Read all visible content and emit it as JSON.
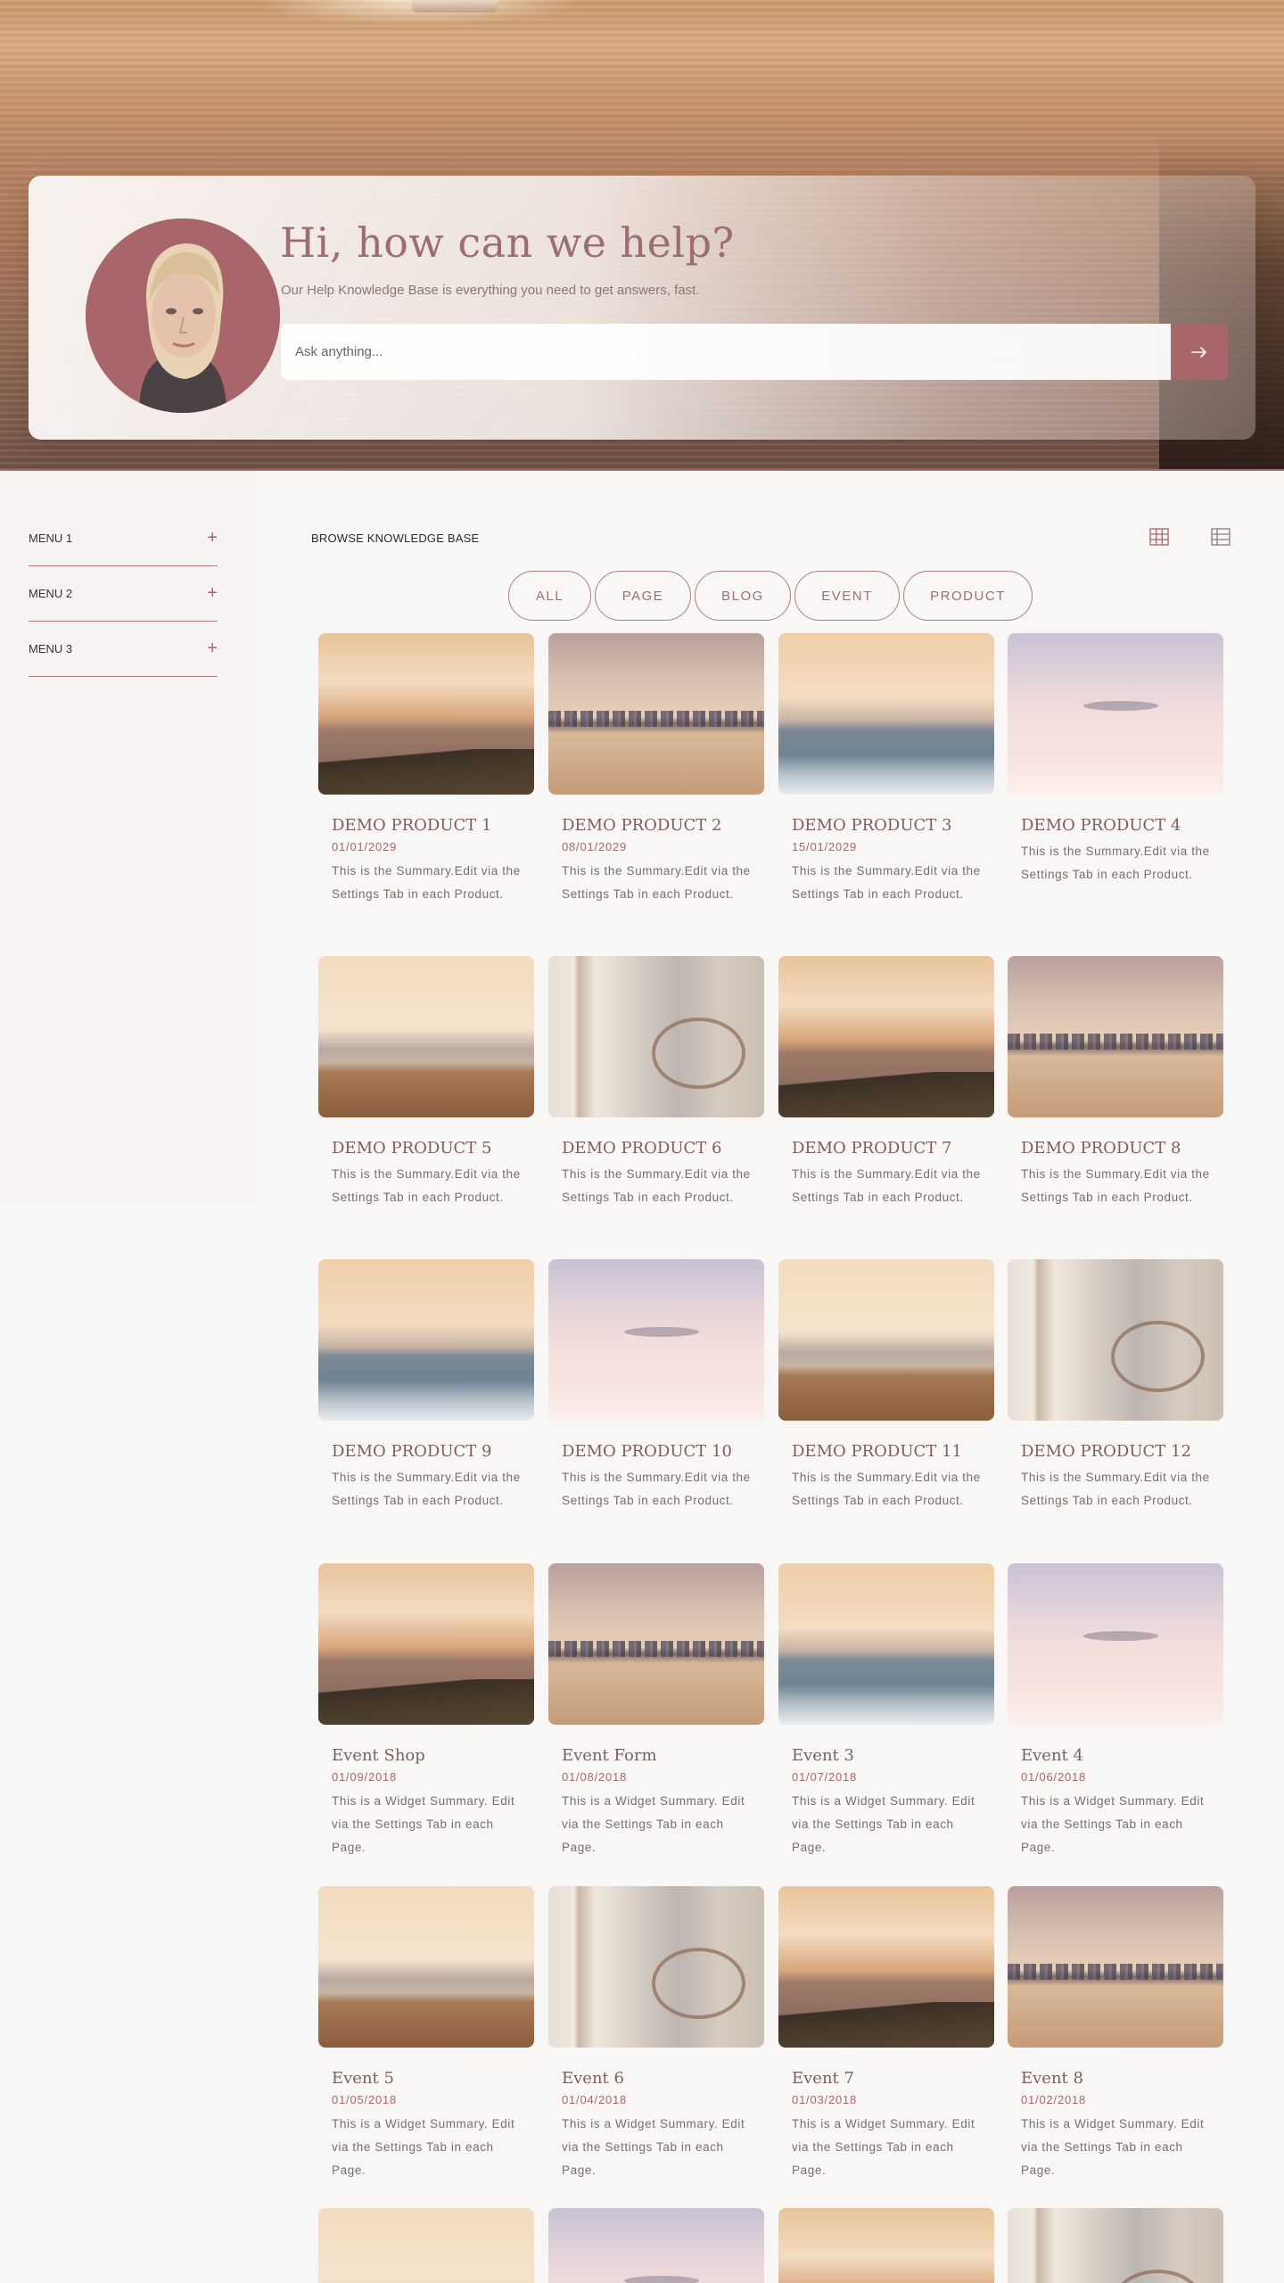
{
  "colors": {
    "accent": "#a8666a",
    "title": "#9c6e72",
    "background": "#f9f7f6"
  },
  "hero": {
    "title": "Hi, how can we help?",
    "subtitle": "Our Help Knowledge Base is everything you need to get answers, fast.",
    "search_placeholder": "Ask anything...",
    "search_icon": "arrow-right-icon"
  },
  "sidebar": {
    "items": [
      {
        "label": "MENU 1",
        "icon": "plus-icon"
      },
      {
        "label": "MENU 2",
        "icon": "plus-icon"
      },
      {
        "label": "MENU 3",
        "icon": "plus-icon"
      }
    ]
  },
  "main": {
    "browse_title": "BROWSE KNOWLEDGE BASE",
    "view_icons": [
      "grid-view-icon",
      "list-view-icon"
    ],
    "filters": [
      "ALL",
      "PAGE",
      "BLOG",
      "EVENT",
      "PRODUCT"
    ]
  },
  "cards": [
    {
      "title": "DEMO PRODUCT 1",
      "date": "01/01/2029",
      "summary": "This is the Summary.Edit via the Settings Tab in each Product.",
      "scene": "sunset"
    },
    {
      "title": "DEMO PRODUCT 2",
      "date": "08/01/2029",
      "summary": "This is the Summary.Edit via the Settings Tab in each Product.",
      "scene": "city"
    },
    {
      "title": "DEMO PRODUCT 3",
      "date": "15/01/2029",
      "summary": "This is the Summary.Edit via the Settings Tab in each Product.",
      "scene": "waves"
    },
    {
      "title": "DEMO PRODUCT 4",
      "date": "",
      "summary": "This is the Summary.Edit via the Settings Tab in each Product.",
      "scene": "mist"
    },
    {
      "title": "DEMO PRODUCT 5",
      "date": "",
      "summary": "This is the Summary.Edit via the Settings Tab in each Product.",
      "scene": "grass"
    },
    {
      "title": "DEMO PRODUCT 6",
      "date": "",
      "summary": "This is the Summary.Edit via the Settings Tab in each Product.",
      "scene": "bike"
    },
    {
      "title": "DEMO PRODUCT 7",
      "date": "",
      "summary": "This is the Summary.Edit via the Settings Tab in each Product.",
      "scene": "sunset"
    },
    {
      "title": "DEMO PRODUCT 8",
      "date": "",
      "summary": "This is the Summary.Edit via the Settings Tab in each Product.",
      "scene": "city"
    },
    {
      "title": "DEMO PRODUCT 9",
      "date": "",
      "summary": "This is the Summary.Edit via the Settings Tab in each Product.",
      "scene": "waves"
    },
    {
      "title": "DEMO PRODUCT 10",
      "date": "",
      "summary": "This is the Summary.Edit via the Settings Tab in each Product.",
      "scene": "mist"
    },
    {
      "title": "DEMO PRODUCT 11",
      "date": "",
      "summary": "This is the Summary.Edit via the Settings Tab in each Product.",
      "scene": "grass"
    },
    {
      "title": "DEMO PRODUCT 12",
      "date": "",
      "summary": "This is the Summary.Edit via the Settings Tab in each Product.",
      "scene": "bike"
    },
    {
      "title": "Event Shop",
      "date": "01/09/2018",
      "summary": "This is a Widget Summary. Edit via the Settings Tab in each Page.",
      "scene": "sunset"
    },
    {
      "title": "Event Form",
      "date": "01/08/2018",
      "summary": "This is a Widget Summary. Edit via the Settings Tab in each Page.",
      "scene": "city"
    },
    {
      "title": "Event 3",
      "date": "01/07/2018",
      "summary": "This is a Widget Summary. Edit via the Settings Tab in each Page.",
      "scene": "waves"
    },
    {
      "title": "Event 4",
      "date": "01/06/2018",
      "summary": "This is a Widget Summary. Edit via the Settings Tab in each Page.",
      "scene": "mist"
    },
    {
      "title": "Event 5",
      "date": "01/05/2018",
      "summary": "This is a Widget Summary. Edit via the Settings Tab in each Page.",
      "scene": "grass"
    },
    {
      "title": "Event 6",
      "date": "01/04/2018",
      "summary": "This is a Widget Summary. Edit via the Settings Tab in each Page.",
      "scene": "bike"
    },
    {
      "title": "Event 7",
      "date": "01/03/2018",
      "summary": "This is a Widget Summary. Edit via the Settings Tab in each Page.",
      "scene": "sunset"
    },
    {
      "title": "Event 8",
      "date": "01/02/2018",
      "summary": "This is a Widget Summary. Edit via the Settings Tab in each Page.",
      "scene": "city"
    },
    {
      "title": "",
      "date": "",
      "summary": "",
      "scene": "grass"
    },
    {
      "title": "",
      "date": "",
      "summary": "",
      "scene": "mist"
    },
    {
      "title": "",
      "date": "",
      "summary": "",
      "scene": "sunset"
    },
    {
      "title": "",
      "date": "",
      "summary": "",
      "scene": "bike"
    }
  ]
}
